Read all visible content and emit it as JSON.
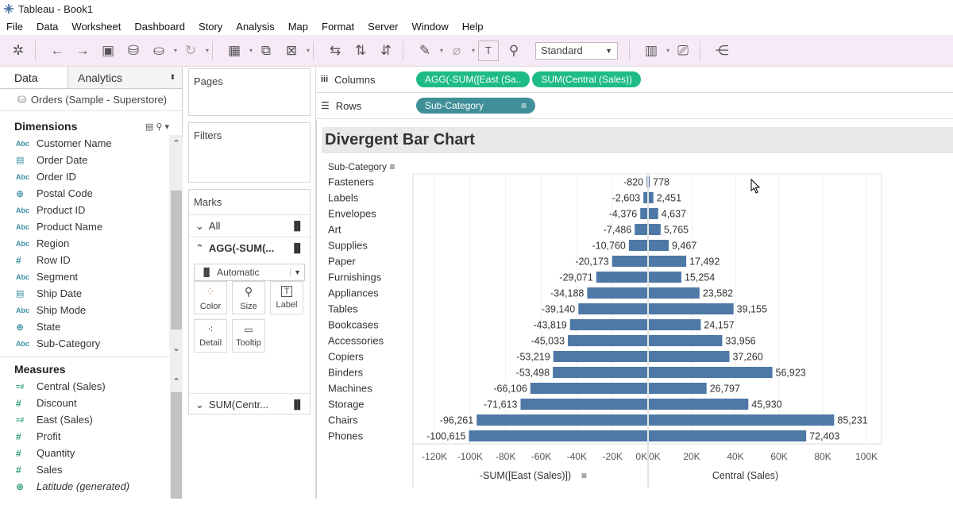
{
  "window": {
    "title": "Tableau - Book1"
  },
  "menu": [
    "File",
    "Data",
    "Worksheet",
    "Dashboard",
    "Story",
    "Analysis",
    "Map",
    "Format",
    "Server",
    "Window",
    "Help"
  ],
  "toolbar": {
    "fit_select": "Standard"
  },
  "left_panel": {
    "tab_data": "Data",
    "tab_analytics": "Analytics",
    "datasource": "Orders (Sample - Superstore)",
    "dimensions_label": "Dimensions",
    "dimensions": [
      {
        "icon": "Abc",
        "name": "Customer Name"
      },
      {
        "icon": "date",
        "name": "Order Date"
      },
      {
        "icon": "Abc",
        "name": "Order ID"
      },
      {
        "icon": "globe",
        "name": "Postal Code"
      },
      {
        "icon": "Abc",
        "name": "Product ID"
      },
      {
        "icon": "Abc",
        "name": "Product Name"
      },
      {
        "icon": "Abc",
        "name": "Region"
      },
      {
        "icon": "#",
        "name": "Row ID"
      },
      {
        "icon": "Abc",
        "name": "Segment"
      },
      {
        "icon": "date",
        "name": "Ship Date"
      },
      {
        "icon": "Abc",
        "name": "Ship Mode"
      },
      {
        "icon": "globe",
        "name": "State"
      },
      {
        "icon": "Abc",
        "name": "Sub-Category"
      }
    ],
    "measures_label": "Measures",
    "measures": [
      {
        "icon": "=#",
        "name": "Central (Sales)"
      },
      {
        "icon": "#",
        "name": "Discount"
      },
      {
        "icon": "=#",
        "name": "East (Sales)"
      },
      {
        "icon": "#",
        "name": "Profit"
      },
      {
        "icon": "#",
        "name": "Quantity"
      },
      {
        "icon": "#",
        "name": "Sales"
      },
      {
        "icon": "globe",
        "name": "Latitude (generated)"
      }
    ]
  },
  "mid_panel": {
    "pages": "Pages",
    "filters": "Filters",
    "marks": "Marks",
    "all": "All",
    "agg_card": "AGG(-SUM(...",
    "mark_type": "Automatic",
    "buttons": {
      "color": "Color",
      "size": "Size",
      "label": "Label",
      "detail": "Detail",
      "tooltip": "Tooltip"
    },
    "sum_card": "SUM(Centr..."
  },
  "shelves": {
    "columns_label": "Columns",
    "rows_label": "Rows",
    "columns_pills": [
      "AGG(-SUM([East (Sa..",
      "SUM(Central (Sales))"
    ],
    "rows_pill": "Sub-Category"
  },
  "view": {
    "title": "Divergent Bar Chart",
    "subcat_header": "Sub-Category"
  },
  "chart_data": {
    "type": "bar",
    "categories": [
      "Fasteners",
      "Labels",
      "Envelopes",
      "Art",
      "Supplies",
      "Paper",
      "Furnishings",
      "Appliances",
      "Tables",
      "Bookcases",
      "Accessories",
      "Copiers",
      "Binders",
      "Machines",
      "Storage",
      "Chairs",
      "Phones"
    ],
    "series": [
      {
        "name": "-SUM([East (Sales)])",
        "values": [
          -820,
          -2603,
          -4376,
          -7486,
          -10760,
          -20173,
          -29071,
          -34188,
          -39140,
          -43819,
          -45033,
          -53219,
          -53498,
          -66106,
          -71613,
          -96261,
          -100615
        ]
      },
      {
        "name": "Central (Sales)",
        "values": [
          778,
          2451,
          4637,
          5765,
          9467,
          17492,
          15254,
          23582,
          39155,
          24157,
          33956,
          37260,
          56923,
          26797,
          45930,
          85231,
          72403
        ]
      }
    ],
    "left_value_labels": [
      "-820",
      "-2,603",
      "-4,376",
      "-7,486",
      "-10,760",
      "-20,173",
      "-29,071",
      "-34,188",
      "-39,140",
      "-43,819",
      "-45,033",
      "-53,219",
      "-53,498",
      "-66,106",
      "-71,613",
      "-96,261",
      "-100,615"
    ],
    "right_value_labels": [
      "778",
      "2,451",
      "4,637",
      "5,765",
      "9,467",
      "17,492",
      "15,254",
      "23,582",
      "39,155",
      "24,157",
      "33,956",
      "37,260",
      "56,923",
      "26,797",
      "45,930",
      "85,231",
      "72,403"
    ],
    "left_axis": {
      "label": "-SUM([East (Sales)])",
      "ticks": [
        "-120K",
        "-100K",
        "-80K",
        "-60K",
        "-40K",
        "-20K",
        "0K"
      ],
      "range": [
        -120000,
        0
      ]
    },
    "right_axis": {
      "label": "Central (Sales)",
      "ticks": [
        "0K",
        "20K",
        "40K",
        "60K",
        "80K",
        "100K"
      ],
      "range": [
        0,
        100000
      ]
    },
    "bar_color": "#4e79a7"
  }
}
